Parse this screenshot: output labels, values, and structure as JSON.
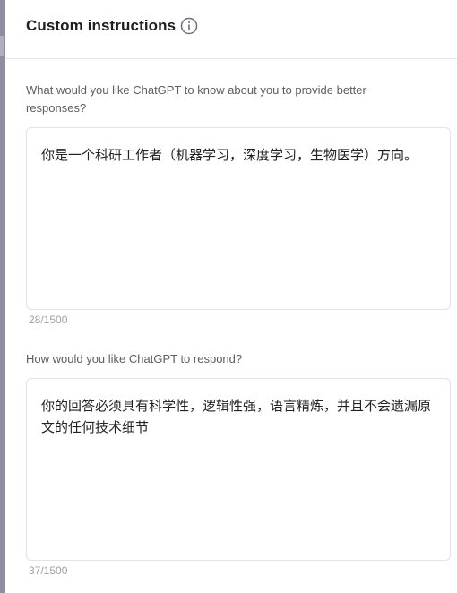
{
  "dialog": {
    "title": "Custom instructions",
    "info_icon": "info-circle-icon"
  },
  "about_you": {
    "question": "What would you like ChatGPT to know about you to provide better responses?",
    "value": "你是一个科研工作者（机器学习，深度学习，生物医学）方向。",
    "counter": "28/1500"
  },
  "respond": {
    "question": "How would you like ChatGPT to respond?",
    "value": "你的回答必须具有科学性，逻辑性强，语言精炼，并且不会遗漏原文的任何技术细节",
    "counter": "37/1500"
  }
}
